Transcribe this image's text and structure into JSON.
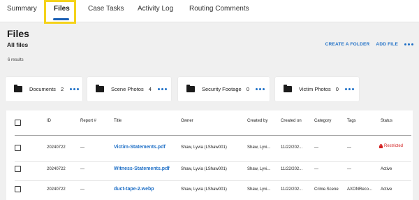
{
  "tabs": [
    {
      "label": "Summary"
    },
    {
      "label": "Files"
    },
    {
      "label": "Case Tasks"
    },
    {
      "label": "Activity Log"
    },
    {
      "label": "Routing Comments"
    }
  ],
  "header": {
    "title": "Files",
    "subtitle": "All files",
    "create_folder": "CREATE A FOLDER",
    "add_file": "ADD FILE",
    "results": "6 results"
  },
  "folders": [
    {
      "name": "Documents",
      "count": "2"
    },
    {
      "name": "Scene Photos",
      "count": "4"
    },
    {
      "name": "Security Footage",
      "count": "0"
    },
    {
      "name": "Victim Photos",
      "count": "0"
    }
  ],
  "table": {
    "columns": [
      "ID",
      "Report #",
      "Title",
      "Owner",
      "Created by",
      "Created on",
      "Category",
      "Tags",
      "Status"
    ],
    "rows": [
      {
        "id": "20240722",
        "report": "—",
        "title": "Victim-Statements.pdf",
        "owner": "Shaw, Lyvia (LShaw001)",
        "created_by": "Shaw, Lyvi...",
        "created_on": "11/22/202...",
        "category": "—",
        "tags": "—",
        "status": "Restricted"
      },
      {
        "id": "20240722",
        "report": "—",
        "title": "Witness-Statements.pdf",
        "owner": "Shaw, Lyvia (LShaw001)",
        "created_by": "Shaw, Lyvi...",
        "created_on": "11/22/202...",
        "category": "—",
        "tags": "—",
        "status": "Active"
      },
      {
        "id": "20240722",
        "report": "—",
        "title": "duct-tape-2.webp",
        "owner": "Shaw, Lyvia (LShaw001)",
        "created_by": "Shaw, Lyvi...",
        "created_on": "11/22/202...",
        "category": "Crime.Scene",
        "tags": "AXONReco...",
        "status": "Active"
      }
    ]
  },
  "colors": {
    "accent": "#1e6fc6",
    "restricted": "#d32020",
    "highlight": "#f4d21a"
  }
}
